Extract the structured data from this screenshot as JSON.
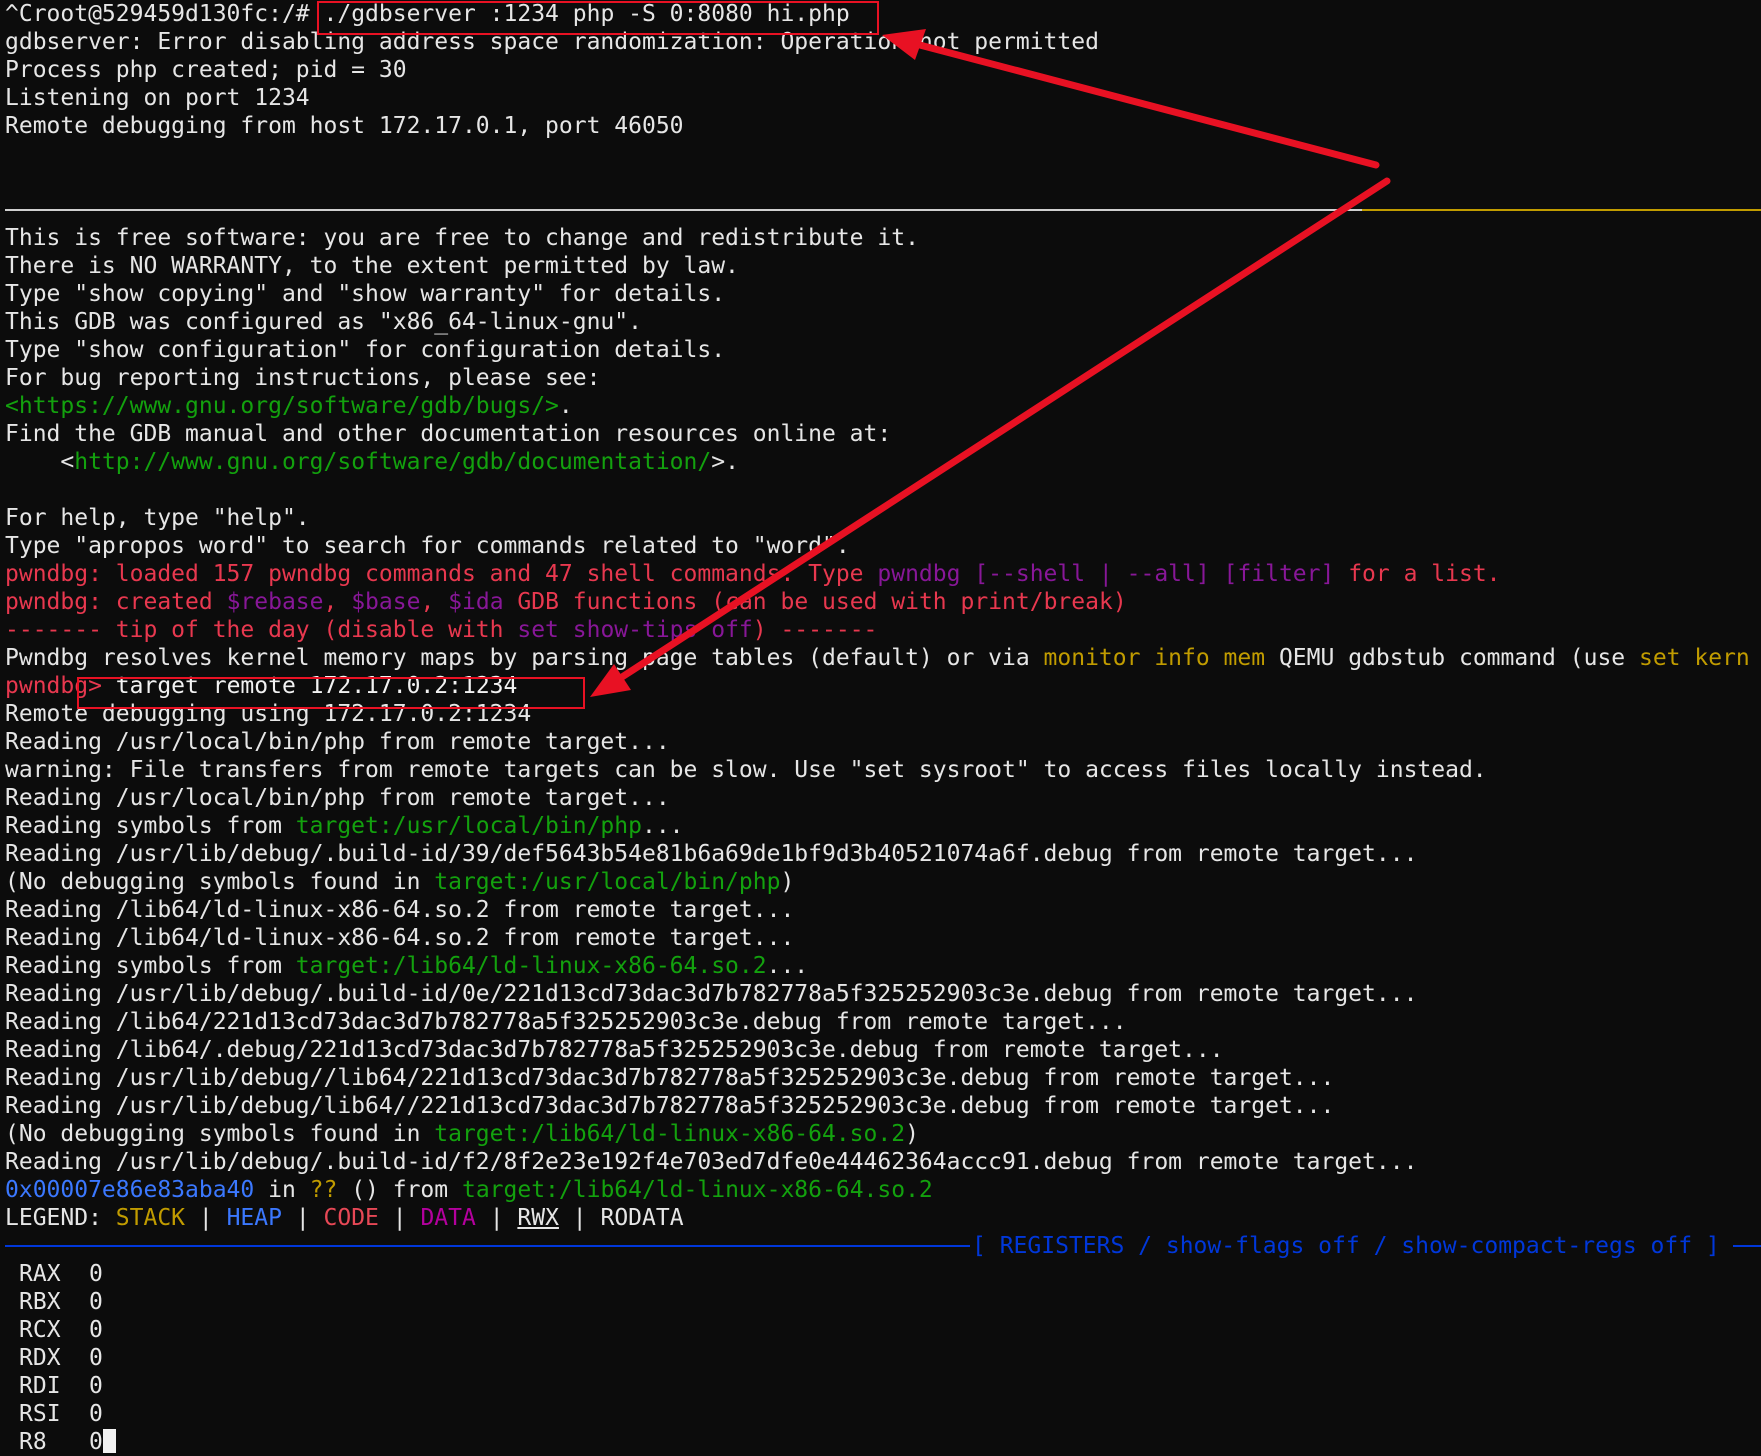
{
  "terminal": {
    "gdbserver": {
      "prompt": "^Croot@529459d130fc:/# ",
      "command": "./gdbserver :1234 php -S 0:8080 hi.php",
      "output": [
        "gdbserver: Error disabling address space randomization: Operation not permitted",
        "Process php created; pid = 30",
        "Listening on port 1234",
        "Remote debugging from host 172.17.0.1, port 46050"
      ]
    },
    "gdb_banner": {
      "lines": [
        "This is free software: you are free to change and redistribute it.",
        "There is NO WARRANTY, to the extent permitted by law.",
        "Type \"show copying\" and \"show warranty\" for details.",
        "This GDB was configured as \"x86_64-linux-gnu\".",
        "Type \"show configuration\" for configuration details.",
        "For bug reporting instructions, please see:"
      ],
      "bugs_url": "<https://www.gnu.org/software/gdb/bugs/>",
      "bugs_suffix": ".",
      "manual_line": "Find the GDB manual and other documentation resources online at:",
      "doc_indent": "    <",
      "doc_url": "http://www.gnu.org/software/gdb/documentation/",
      "doc_suffix": ">.",
      "help_line": "For help, type \"help\".",
      "apropos_line": "Type \"apropos word\" to search for commands related to \"word\"."
    },
    "pwndbg_loaded": {
      "prefix": "pwndbg: loaded 157 pwndbg commands and 47 shell commands. Type ",
      "cmd": "pwndbg [--shell | --all] [filter]",
      "suffix": " for a list."
    },
    "pwndbg_created": {
      "prefix": "pwndbg: created ",
      "rebase": "$rebase",
      "sep1": ", ",
      "base": "$base",
      "sep2": ", ",
      "ida": "$ida",
      "suffix": " GDB functions (can be used with print/break)"
    },
    "tip": {
      "prefix": "------- tip of the day (disable with ",
      "cmd": "set show-tips off",
      "suffix": ") -------"
    },
    "tip_body": {
      "prefix": "Pwndbg resolves kernel memory maps by parsing page tables (default) or via ",
      "monitor": "monitor info mem",
      "middle": " QEMU gdbstub command (use ",
      "set_cmd": "set kern"
    },
    "gdb_prompt": {
      "prompt": "pwndbg",
      "gt": "> ",
      "command": "target remote 172.17.0.2:1234"
    },
    "remote_lines": [
      "Remote debugging using 172.17.0.2:1234",
      "Reading /usr/local/bin/php from remote target...",
      "warning: File transfers from remote targets can be slow. Use \"set sysroot\" to access files locally instead.",
      "Reading /usr/local/bin/php from remote target..."
    ],
    "symbols_php": {
      "prefix": "Reading symbols from ",
      "path": "target:/usr/local/bin/php",
      "suffix": "..."
    },
    "debug_php": "Reading /usr/lib/debug/.build-id/39/def5643b54e81b6a69de1bf9d3b40521074a6f.debug from remote target...",
    "nodebug_php": {
      "prefix": "(No debugging symbols found in ",
      "path": "target:/usr/local/bin/php",
      "suffix": ")"
    },
    "ld_lines": [
      "Reading /lib64/ld-linux-x86-64.so.2 from remote target...",
      "Reading /lib64/ld-linux-x86-64.so.2 from remote target..."
    ],
    "symbols_ld": {
      "prefix": "Reading symbols from ",
      "path": "target:/lib64/ld-linux-x86-64.so.2",
      "suffix": "..."
    },
    "debug_ld_lines": [
      "Reading /usr/lib/debug/.build-id/0e/221d13cd73dac3d7b782778a5f325252903c3e.debug from remote target...",
      "Reading /lib64/221d13cd73dac3d7b782778a5f325252903c3e.debug from remote target...",
      "Reading /lib64/.debug/221d13cd73dac3d7b782778a5f325252903c3e.debug from remote target...",
      "Reading /usr/lib/debug//lib64/221d13cd73dac3d7b782778a5f325252903c3e.debug from remote target...",
      "Reading /usr/lib/debug/lib64//221d13cd73dac3d7b782778a5f325252903c3e.debug from remote target..."
    ],
    "nodebug_ld": {
      "prefix": "(No debugging symbols found in ",
      "path": "target:/lib64/ld-linux-x86-64.so.2",
      "suffix": ")"
    },
    "debug_f2": "Reading /usr/lib/debug/.build-id/f2/8f2e23e192f4e703ed7dfe0e44462364accc91.debug from remote target...",
    "stop_line": {
      "addr": "0x00007e86e83aba40",
      "in": " in ",
      "qq": "??",
      "from": " () from ",
      "path": "target:/lib64/ld-linux-x86-64.so.2"
    },
    "legend": {
      "label": "LEGEND: ",
      "stack": "STACK",
      "heap": "HEAP",
      "code": "CODE",
      "data": "DATA",
      "rwx": "RWX",
      "rodata": "RODATA",
      "sep": " | "
    },
    "registers_header": "[ REGISTERS / show-flags off / show-compact-regs off ]",
    "registers": [
      {
        "name": "RAX",
        "value": "0"
      },
      {
        "name": "RBX",
        "value": "0"
      },
      {
        "name": "RCX",
        "value": "0"
      },
      {
        "name": "RDX",
        "value": "0"
      },
      {
        "name": "RDI",
        "value": "0"
      },
      {
        "name": "RSI",
        "value": "0"
      },
      {
        "name": "R8",
        "value": "0"
      }
    ]
  },
  "colors": {
    "background": "#0c0c0c",
    "text": "#e6e6e6",
    "green": "#13a10e",
    "pwndbg_red": "#e8384f",
    "purple": "#881798",
    "yellow": "#c19c00",
    "blue": "#0037da",
    "annotation_red": "#e81123"
  }
}
